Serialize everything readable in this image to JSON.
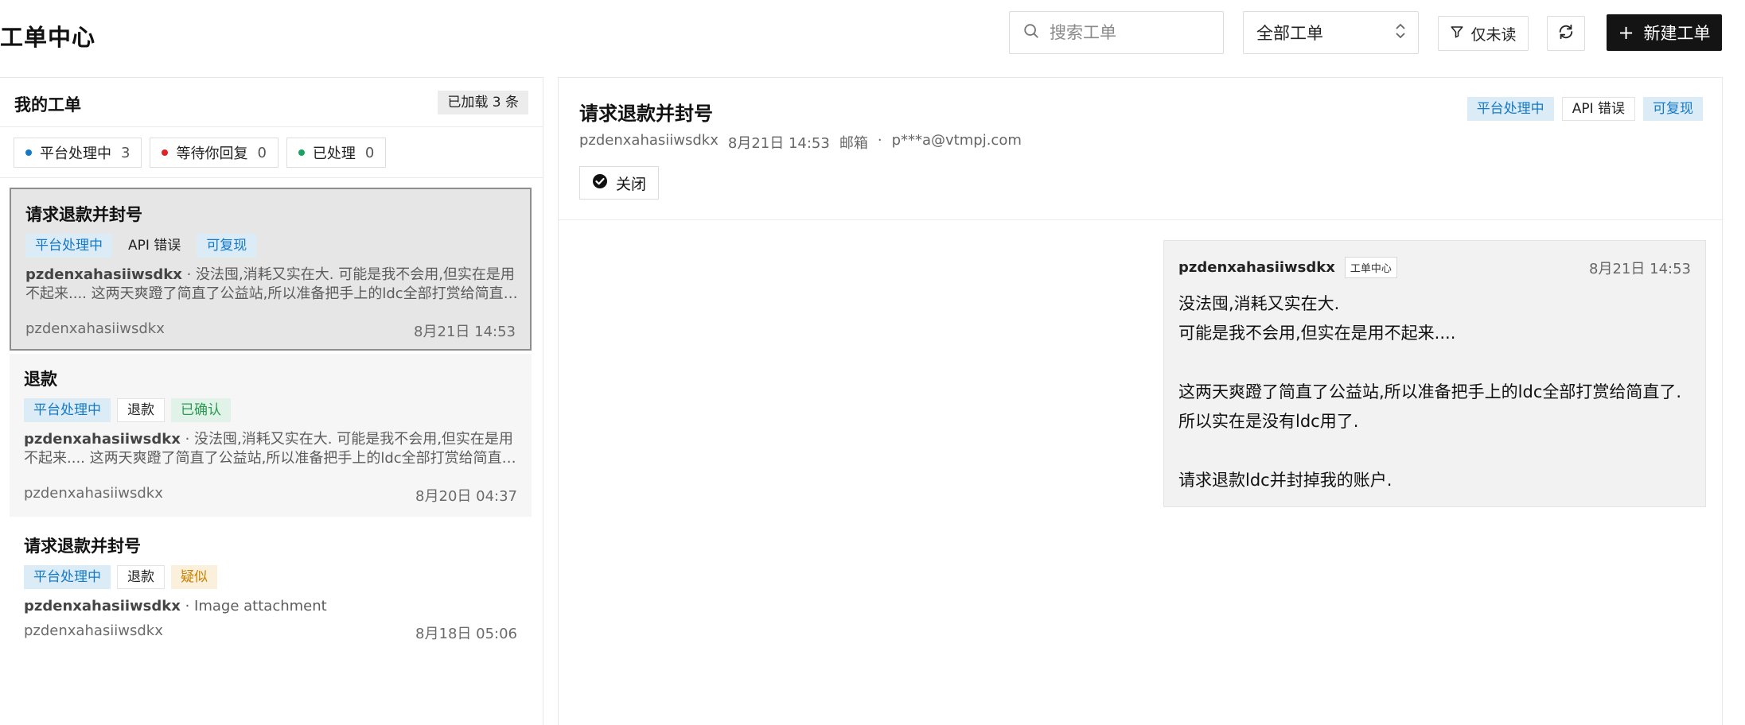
{
  "header": {
    "title": "工单中心",
    "search_placeholder": "搜索工单",
    "filter_select": "全部工单",
    "unread_only": "仅未读",
    "new_ticket": "新建工单"
  },
  "sidebar": {
    "title": "我的工单",
    "loaded": "已加载 3 条",
    "filters": [
      {
        "label": "平台处理中",
        "count": "3",
        "color": "#1479c6"
      },
      {
        "label": "等待你回复",
        "count": "0",
        "color": "#e02424"
      },
      {
        "label": "已处理",
        "count": "0",
        "color": "#1aa260"
      }
    ],
    "tickets": [
      {
        "title": "请求退款并封号",
        "tags": [
          "平台处理中",
          "API 错误",
          "可复现"
        ],
        "author": "pzdenxahasiiwsdkx",
        "preview": "没法囤,消耗又实在大. 可能是我不会用,但实在是用不起来.... 这两天爽蹬了简直了公益站,所以准备把手上的ldc全部打赏给简直了. 所以实在是没有ldc用了. 请求退款ldc并封掉我的账户.",
        "user": "pzdenxahasiiwsdkx",
        "time": "8月21日 14:53"
      },
      {
        "title": "退款",
        "tags": [
          "平台处理中",
          "退款",
          "已确认"
        ],
        "author": "pzdenxahasiiwsdkx",
        "preview": "没法囤,消耗又实在大. 可能是我不会用,但实在是用不起来.... 这两天爽蹬了简直了公益站,所以准备把手上的ldc全部打赏给简直了.",
        "user": "pzdenxahasiiwsdkx",
        "time": "8月20日 04:37"
      },
      {
        "title": "请求退款并封号",
        "tags": [
          "平台处理中",
          "退款",
          "疑似"
        ],
        "author": "pzdenxahasiiwsdkx",
        "preview": "Image attachment",
        "user": "pzdenxahasiiwsdkx",
        "time": "8月18日 05:06"
      }
    ]
  },
  "detail": {
    "title": "请求退款并封号",
    "tags": [
      "平台处理中",
      "API 错误",
      "可复现"
    ],
    "meta": {
      "user": "pzdenxahasiiwsdkx",
      "time": "8月21日 14:53",
      "email_label": "邮箱",
      "separator": "·",
      "email": "p***a@vtmpj.com"
    },
    "close_button": "关闭",
    "message": {
      "author": "pzdenxahasiiwsdkx",
      "source": "工单中心",
      "time": "8月21日 14:53",
      "lines": [
        "没法囤,消耗又实在大.",
        "可能是我不会用,但实在是用不起来....",
        "",
        "这两天爽蹬了简直了公益站,所以准备把手上的ldc全部打赏给简直了.",
        "所以实在是没有ldc用了.",
        "",
        "请求退款ldc并封掉我的账户."
      ]
    }
  }
}
